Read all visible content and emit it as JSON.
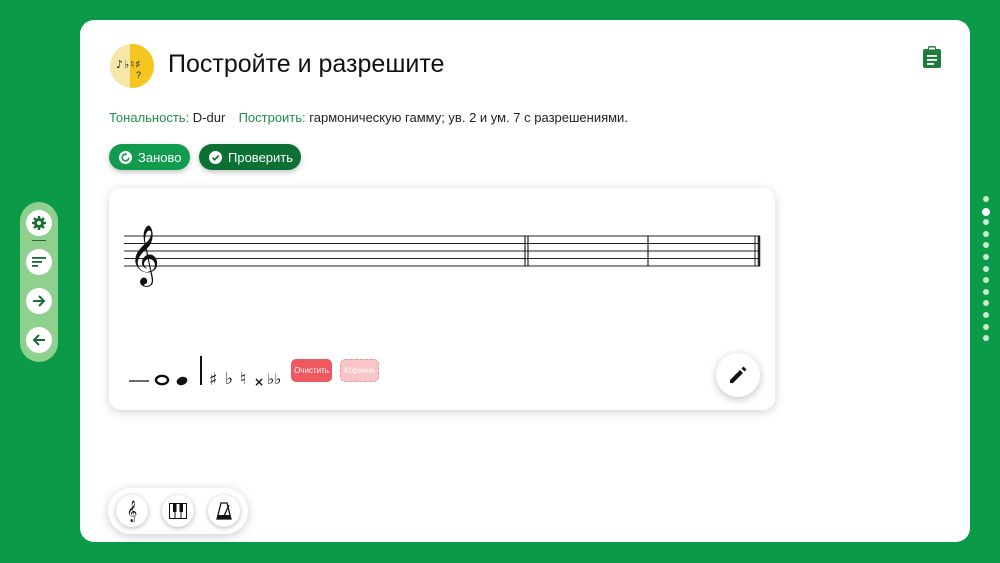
{
  "header": {
    "title": "Постройте и разрешите",
    "logo_marks": "♪♭♮♯",
    "logo_mark2": "?"
  },
  "task": {
    "key_label": "Тональность:",
    "key_value": "D-dur",
    "build_label": "Построить:",
    "build_value": "гармоническую гамму; ув. 2 и ум. 7 с разрешениями."
  },
  "actions": {
    "reset_label": "Заново",
    "check_label": "Проверить"
  },
  "editor": {
    "clear_label": "Очистить",
    "basket_label": "Корзина",
    "tools": [
      "ledger-line",
      "whole-note",
      "quarter-note",
      "barline",
      "sharp",
      "flat",
      "natural",
      "double-sharp",
      "double-flat"
    ],
    "tool_glyphs": {
      "sharp": "♯",
      "flat": "♭",
      "natural": "♮",
      "double_sharp": "×",
      "double_flat": "♭♭"
    }
  },
  "colors": {
    "background": "#0a9a48",
    "accent_green": "#119b4e",
    "dark_green": "#0c6f33",
    "label_green": "#1e8f4a",
    "clear_red": "#ef5860"
  },
  "pagination": {
    "total": 13,
    "active": 2
  },
  "sidebar_icons": [
    "gear-icon",
    "sort-icon",
    "arrow-right-icon",
    "arrow-left-icon"
  ],
  "bottom_icons": [
    "treble-clef-icon",
    "piano-icon",
    "metronome-icon"
  ]
}
